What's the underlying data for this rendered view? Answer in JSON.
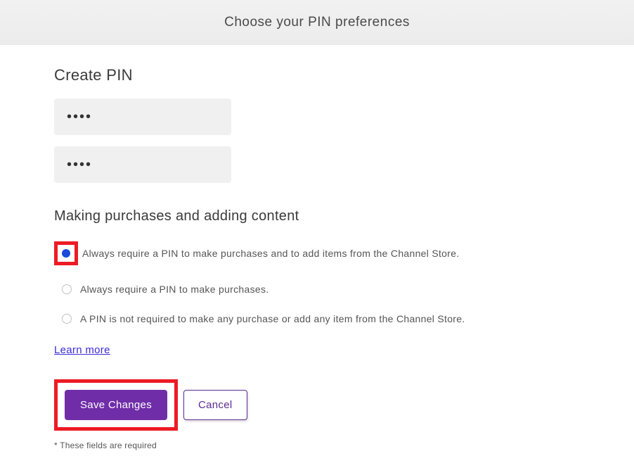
{
  "header": {
    "title": "Choose your PIN preferences"
  },
  "createPin": {
    "title": "Create PIN",
    "pin1": "••••",
    "pin2": "••••"
  },
  "purchases": {
    "title": "Making purchases and adding content",
    "options": [
      {
        "label": "Always require a PIN to make purchases and to add items from the Channel Store.",
        "selected": true
      },
      {
        "label": "Always require a PIN to make purchases.",
        "selected": false
      },
      {
        "label": "A PIN is not required to make any purchase or add any item from the Channel Store.",
        "selected": false
      }
    ],
    "learnMore": "Learn more"
  },
  "buttons": {
    "save": "Save Changes",
    "cancel": "Cancel"
  },
  "footer": {
    "requiredNote": "* These fields are required"
  },
  "colors": {
    "highlight": "#ed1b24",
    "primary": "#6f2da8"
  }
}
